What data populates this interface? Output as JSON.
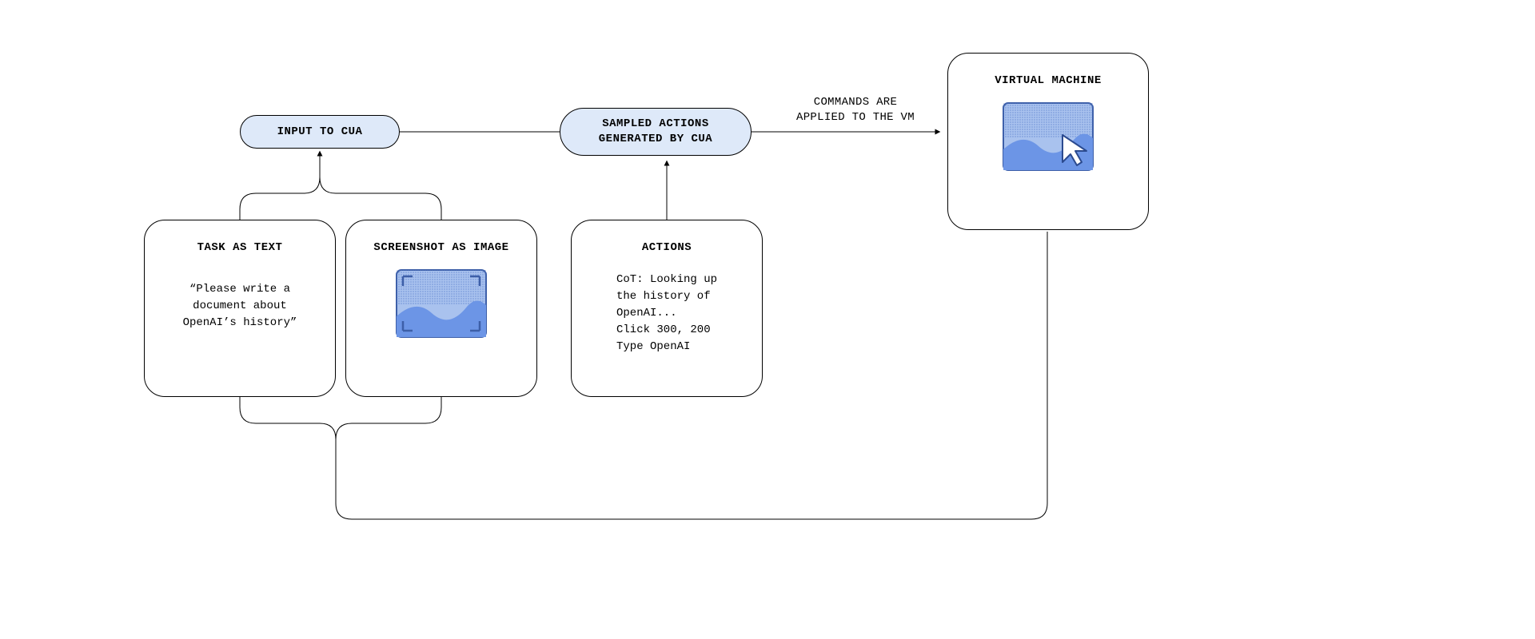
{
  "pills": {
    "input": "INPUT TO CUA",
    "sampled": "SAMPLED ACTIONS\nGENERATED BY CUA"
  },
  "cards": {
    "task": {
      "title": "TASK AS TEXT",
      "body": "“Please write a\ndocument about\nOpenAI’s history”"
    },
    "screenshot": {
      "title": "SCREENSHOT AS IMAGE"
    },
    "actions": {
      "title": "ACTIONS",
      "body": "CoT: Looking up\nthe history of\nOpenAI...\nClick 300, 200\nType OpenAI"
    },
    "vm": {
      "title": "VIRTUAL MACHINE"
    }
  },
  "labels": {
    "apply": "COMMANDS ARE\nAPPLIED TO THE VM"
  },
  "colors": {
    "pill_bg": "#DEE9F9",
    "image_blue": "#6C95E6",
    "image_blue_light": "#A9C2EE"
  }
}
